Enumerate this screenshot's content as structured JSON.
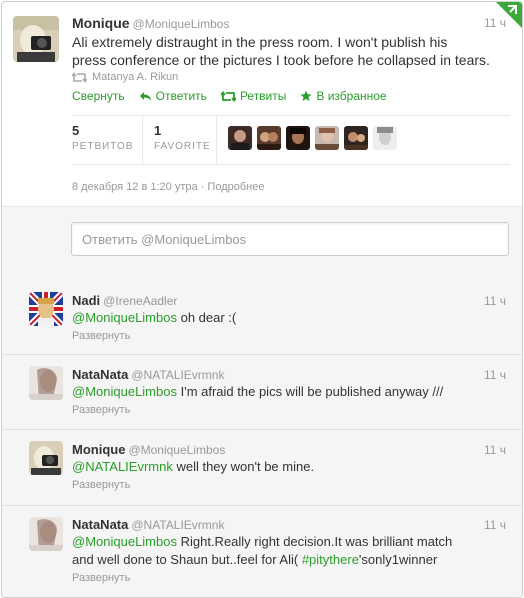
{
  "main_tweet": {
    "name": "Monique",
    "handle": "@MoniqueLimbos",
    "time": "11 ч",
    "text_line1": "Ali extremely distraught in the press room. I won't publish his",
    "text_line2": "press conference or the pictures I took before he collapsed in tears.",
    "retweeted_by": "Matanya A. Rikun",
    "actions": {
      "collapse": "Свернуть",
      "reply": "Ответить",
      "retweets": "Ретвиты",
      "favorite": "В избранное"
    },
    "stats": {
      "retweets_count": "5",
      "retweets_label": "РЕТВИТОВ",
      "favorite_count": "1",
      "favorite_label": "FAVORITE"
    },
    "meta_date": "8 декабря 12 в 1:20 утра",
    "meta_separator": "·",
    "meta_details": "Подробнее"
  },
  "reply_box": {
    "placeholder": "Ответить @MoniqueLimbos"
  },
  "replies": [
    {
      "name": "Nadi",
      "handle": "@IreneAadler",
      "time": "11 ч",
      "mention": "@MoniqueLimbos",
      "text": " oh dear :(",
      "expand": "Развернуть"
    },
    {
      "name": "NataNata",
      "handle": "@NATALIEvrmnk",
      "time": "11 ч",
      "mention": "@MoniqueLimbos",
      "text": " I'm afraid the pics will be published anyway ///",
      "expand": "Развернуть"
    },
    {
      "name": "Monique",
      "handle": "@MoniqueLimbos",
      "time": "11 ч",
      "mention": "@NATALIEvrmnk",
      "text": " well they won't be mine.",
      "expand": "Развернуть"
    },
    {
      "name": "NataNata",
      "handle": "@NATALIEvrmnk",
      "time": "11 ч",
      "mention": "@MoniqueLimbos",
      "text_a": " Right.Really right decision.It was brilliant match",
      "text_b": "and well done to Shaun but..feel for Ali( ",
      "hashtag": "#pitythere",
      "text_c": "'sonly1winner",
      "expand": "Развернуть"
    }
  ],
  "colors": {
    "link": "#2a9d2a",
    "muted": "#999999",
    "text": "#333333",
    "reply_bg": "#f5f5f5"
  }
}
